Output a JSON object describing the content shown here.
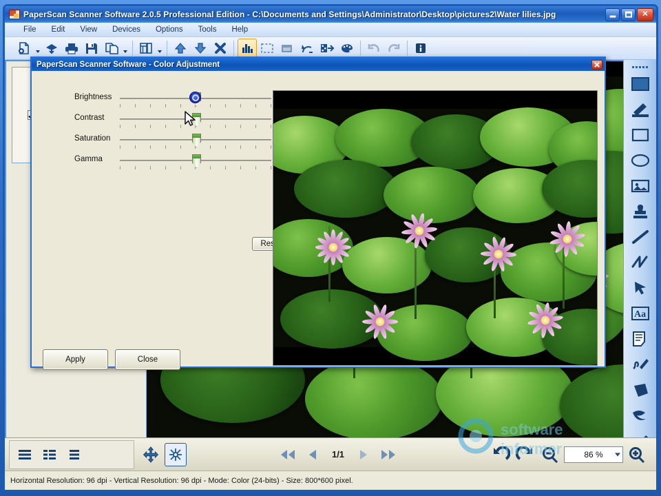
{
  "window": {
    "title": "PaperScan Scanner Software 2.0.5 Professional Edition - C:\\Documents and Settings\\Administrator\\Desktop\\pictures2\\Water lilies.jpg",
    "minimize_label": "",
    "maximize_label": "",
    "close_label": "✕",
    "icon": "app-icon"
  },
  "menubar": {
    "items": [
      {
        "label": "File"
      },
      {
        "label": "Edit"
      },
      {
        "label": "View"
      },
      {
        "label": "Devices"
      },
      {
        "label": "Options"
      },
      {
        "label": "Tools"
      },
      {
        "label": "Help"
      }
    ]
  },
  "toolbar": {
    "buttons": [
      {
        "name": "acquire-image-icon",
        "active": false
      },
      {
        "name": "import-image-icon",
        "active": false
      },
      {
        "name": "print-icon",
        "active": false
      },
      {
        "name": "save-icon",
        "active": false
      },
      {
        "name": "duplicate-page-icon",
        "active": false
      },
      {
        "name": "page-setup-icon",
        "active": false
      },
      {
        "name": "move-page-up-icon",
        "active": false
      },
      {
        "name": "move-page-down-icon",
        "active": false
      },
      {
        "name": "delete-page-icon",
        "active": false
      },
      {
        "name": "histogram-icon",
        "active": true
      },
      {
        "name": "select-region-icon",
        "active": false
      },
      {
        "name": "crop-icon",
        "active": false
      },
      {
        "name": "rotate-angle-icon",
        "active": false
      },
      {
        "name": "convert-color-icon",
        "active": false
      },
      {
        "name": "color-adjustment-icon",
        "active": false
      },
      {
        "name": "undo-icon",
        "active": false
      },
      {
        "name": "redo-icon",
        "active": false
      },
      {
        "name": "info-icon",
        "active": false
      }
    ]
  },
  "thumbnails": {
    "items": [
      {
        "checked": true,
        "name": "page-thumbnail-1"
      }
    ]
  },
  "right_toolbar": {
    "tools": [
      {
        "name": "fill-rectangle-tool",
        "selected": false
      },
      {
        "name": "pencil-tool",
        "selected": false
      },
      {
        "name": "rectangle-tool",
        "selected": false
      },
      {
        "name": "ellipse-tool",
        "selected": false
      },
      {
        "name": "image-tool",
        "selected": false
      },
      {
        "name": "stamp-tool",
        "selected": false
      },
      {
        "name": "line-tool",
        "selected": false
      },
      {
        "name": "polyline-tool",
        "selected": false
      },
      {
        "name": "arrow-tool",
        "selected": false
      },
      {
        "name": "text-tool",
        "selected": false
      },
      {
        "name": "note-tool",
        "selected": false
      },
      {
        "name": "freehand-tool",
        "selected": false
      },
      {
        "name": "polygon-tool",
        "selected": false
      },
      {
        "name": "brush-tool",
        "selected": false
      },
      {
        "name": "highlighter-tool",
        "selected": false
      }
    ],
    "text_tool_label": "Aa"
  },
  "bottombar": {
    "view_buttons": [
      {
        "name": "list-view-icon"
      },
      {
        "name": "detail-view-icon"
      },
      {
        "name": "tile-view-icon"
      }
    ],
    "pan_button": {
      "name": "pan-tool-icon"
    },
    "fit_button": {
      "name": "fit-to-window-icon",
      "selected": true
    },
    "nav": {
      "first_label": "◀◀",
      "prev_label": "◀",
      "page_indicator": "1/1",
      "next_label": "▶",
      "last_label": "▶▶"
    },
    "rotate_left": {
      "name": "rotate-left-icon"
    },
    "rotate_right": {
      "name": "rotate-right-icon"
    },
    "zoom_out": {
      "name": "zoom-out-icon"
    },
    "zoom_value": "86 %",
    "zoom_in": {
      "name": "zoom-in-icon"
    }
  },
  "statusbar": {
    "text": "Horizontal Resolution:  96 dpi - Vertical Resolution:  96 dpi - Mode: Color (24-bits) - Size: 800*600 pixel."
  },
  "dialog": {
    "title": "PaperScan Scanner Software - Color Adjustment",
    "close_label": "",
    "sliders": [
      {
        "label": "Brightness",
        "value": 0,
        "focused": true
      },
      {
        "label": "Contrast",
        "value": 0,
        "focused": false
      },
      {
        "label": "Saturation",
        "value": 0,
        "focused": false
      },
      {
        "label": "Gamma",
        "value": 0,
        "focused": false
      }
    ],
    "reset_label": "Reset",
    "apply_label": "Apply",
    "close_button_label": "Close",
    "preview_name": "color-adjustment-preview"
  },
  "colors": {
    "title_blue": "#1c5cbb",
    "dialog_face": "#ece9d8",
    "accent_orange": "#e0a020",
    "close_red": "#bd2f18",
    "icon_blue": "#1c4e8f"
  }
}
